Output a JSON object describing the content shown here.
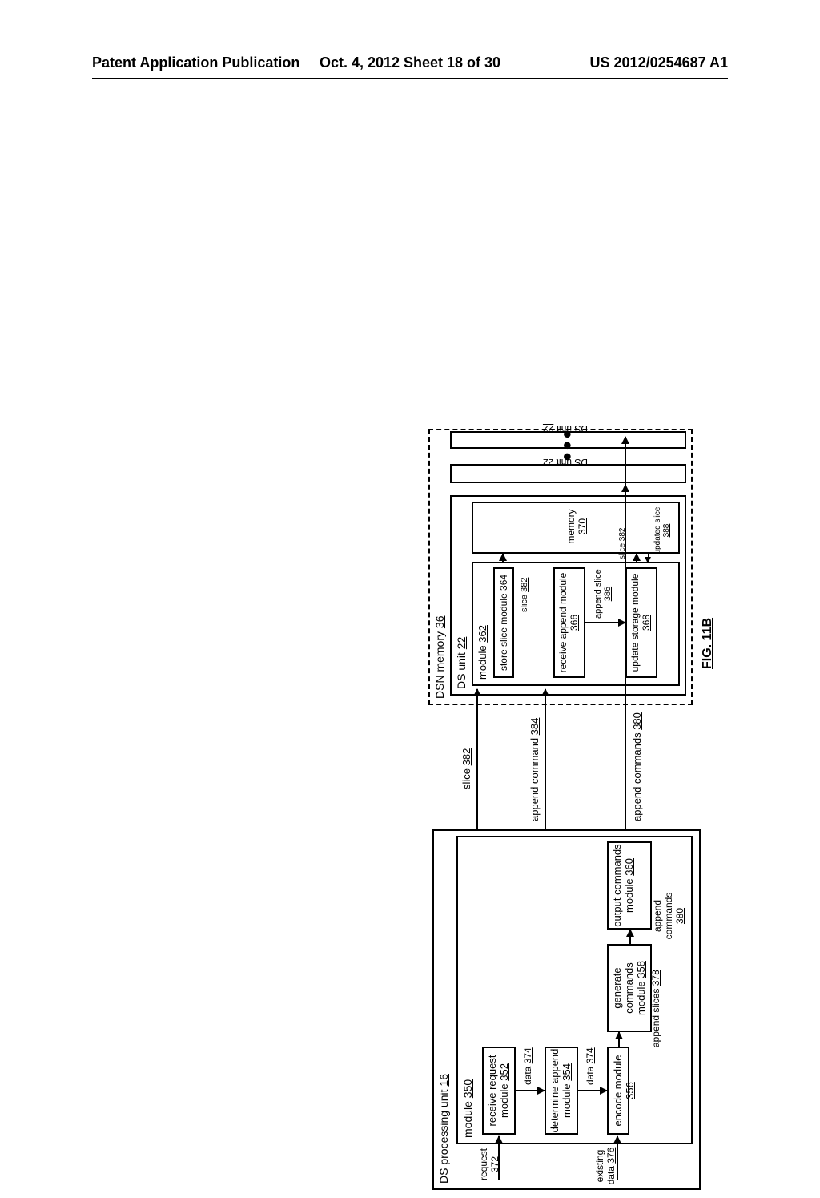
{
  "header": {
    "left": "Patent Application Publication",
    "center": "Oct. 4, 2012  Sheet 18 of 30",
    "right": "US 2012/0254687 A1"
  },
  "figure": {
    "label": "FIG. 11B",
    "ds_proc_unit": {
      "title": "DS processing unit",
      "num": "16"
    },
    "module_350": {
      "title": "module",
      "num": "350"
    },
    "recv_request": {
      "title": "receive request module",
      "num": "352"
    },
    "det_append": {
      "title": "determine append module",
      "num": "354"
    },
    "encode": {
      "title": "encode module",
      "num": "356"
    },
    "gen_cmds": {
      "title": "generate commands module",
      "num": "358"
    },
    "out_cmds": {
      "title": "output commands module",
      "num": "360"
    },
    "request": {
      "title": "request",
      "num": "372"
    },
    "data_374a": {
      "title": "data",
      "num": "374"
    },
    "data_374b": {
      "title": "data",
      "num": "374"
    },
    "existing_data": {
      "title": "existing data",
      "num": "376"
    },
    "append_slices": {
      "title": "append slices",
      "num": "378"
    },
    "append_cmds_380a": {
      "title": "append commands",
      "num": "380"
    },
    "append_cmds_380b": {
      "title": "append commands",
      "num": "380"
    },
    "slice_382a": {
      "title": "slice",
      "num": "382"
    },
    "slice_382b": {
      "title": "slice",
      "num": "382"
    },
    "slice_382c": {
      "title": "slice",
      "num": "382"
    },
    "append_cmd_384": {
      "title": "append command",
      "num": "384"
    },
    "append_slice_386": {
      "title": "append slice",
      "num": "386"
    },
    "updated_slice_388": {
      "title": "updated slice",
      "num": "388"
    },
    "dsn_memory": {
      "title": "DSN memory",
      "num": "36"
    },
    "ds_unit_22a": {
      "title": "DS unit",
      "num": "22"
    },
    "ds_unit_22b": {
      "title": "DS unit",
      "num": "22"
    },
    "ds_unit_22c": {
      "title": "DS unit",
      "num": "22"
    },
    "module_362": {
      "title": "module",
      "num": "362"
    },
    "store_slice": {
      "title": "store slice module",
      "num": "364"
    },
    "recv_append": {
      "title": "receive append module",
      "num": "366"
    },
    "update_storage": {
      "title": "update storage module",
      "num": "368"
    },
    "memory_370": {
      "title": "memory",
      "num": "370"
    },
    "dots": "●●●"
  },
  "chart_data": {
    "type": "diagram",
    "description": "Block diagram FIG. 11B showing a DS processing unit 16 containing module 350 (with receive request module 352, determine append module 354, encode module 356, generate commands module 358, output commands module 360) sending slice 382 and append command 384 and append commands 380 to DSN memory 36 which contains multiple DS units 22. One DS unit 22 contains module 362 (store slice module 364, receive append module 366, update storage module 368) and memory 370. Data flows: request 372 → receive request module 352 → data 374 → determine append module 354 → data 374 → encode module 356 (also receives existing data 376) → append slices 378 → generate commands module 358 → append commands 380 → output commands module 360. Output commands module 360 sends slice 382 to store slice module 364, append command 384 to receive append module 366, and append commands 380 to other DS units 22. Store slice module 364 sends slice 382 to memory 370. Receive append module 366 sends append slice 386 to update storage module 368. Update storage module 368 exchanges slice 382 and updated slice 388 with memory 370.",
    "blocks": [
      {
        "id": "ds_processing_unit",
        "ref": 16,
        "contains": [
          "module_350"
        ]
      },
      {
        "id": "module_350",
        "ref": 350,
        "contains": [
          "receive_request_352",
          "determine_append_354",
          "encode_356",
          "generate_commands_358",
          "output_commands_360"
        ]
      },
      {
        "id": "receive_request_352",
        "ref": 352
      },
      {
        "id": "determine_append_354",
        "ref": 354
      },
      {
        "id": "encode_356",
        "ref": 356
      },
      {
        "id": "generate_commands_358",
        "ref": 358
      },
      {
        "id": "output_commands_360",
        "ref": 360
      },
      {
        "id": "dsn_memory_36",
        "ref": 36,
        "contains": [
          "ds_unit_22_main",
          "ds_unit_22_b",
          "ds_unit_22_c"
        ]
      },
      {
        "id": "ds_unit_22_main",
        "ref": 22,
        "contains": [
          "module_362",
          "memory_370"
        ]
      },
      {
        "id": "module_362",
        "ref": 362,
        "contains": [
          "store_slice_364",
          "receive_append_366",
          "update_storage_368"
        ]
      },
      {
        "id": "store_slice_364",
        "ref": 364
      },
      {
        "id": "receive_append_366",
        "ref": 366
      },
      {
        "id": "update_storage_368",
        "ref": 368
      },
      {
        "id": "memory_370",
        "ref": 370
      },
      {
        "id": "ds_unit_22_b",
        "ref": 22
      },
      {
        "id": "ds_unit_22_c",
        "ref": 22
      }
    ],
    "edges": [
      {
        "from": "external",
        "to": "receive_request_352",
        "label": "request 372"
      },
      {
        "from": "receive_request_352",
        "to": "determine_append_354",
        "label": "data 374"
      },
      {
        "from": "determine_append_354",
        "to": "encode_356",
        "label": "data 374"
      },
      {
        "from": "external",
        "to": "encode_356",
        "label": "existing data 376"
      },
      {
        "from": "encode_356",
        "to": "generate_commands_358",
        "label": "append slices 378"
      },
      {
        "from": "generate_commands_358",
        "to": "output_commands_360",
        "label": "append commands 380"
      },
      {
        "from": "output_commands_360",
        "to": "store_slice_364",
        "label": "slice 382"
      },
      {
        "from": "output_commands_360",
        "to": "receive_append_366",
        "label": "append command 384"
      },
      {
        "from": "output_commands_360",
        "to": "ds_unit_22_b",
        "label": "append commands 380"
      },
      {
        "from": "output_commands_360",
        "to": "ds_unit_22_c",
        "label": "append commands 380"
      },
      {
        "from": "store_slice_364",
        "to": "memory_370",
        "label": "slice 382"
      },
      {
        "from": "receive_append_366",
        "to": "update_storage_368",
        "label": "append slice 386"
      },
      {
        "from": "memory_370",
        "to": "update_storage_368",
        "label": "slice 382"
      },
      {
        "from": "update_storage_368",
        "to": "memory_370",
        "label": "updated slice 388"
      }
    ]
  }
}
